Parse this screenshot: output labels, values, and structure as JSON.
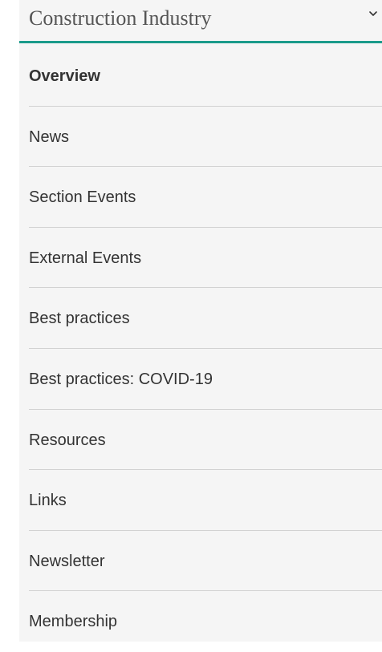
{
  "section": {
    "title": "Construction Industry",
    "toggle_icon": "chevron-down-icon",
    "accent_color": "#1a9a8a"
  },
  "menu": {
    "items": [
      {
        "label": "Overview",
        "active": true
      },
      {
        "label": "News"
      },
      {
        "label": "Section Events"
      },
      {
        "label": "External Events"
      },
      {
        "label": "Best practices"
      },
      {
        "label": "Best practices: COVID-19"
      },
      {
        "label": "Resources"
      },
      {
        "label": "Links"
      },
      {
        "label": "Newsletter"
      },
      {
        "label": "Membership"
      }
    ]
  }
}
